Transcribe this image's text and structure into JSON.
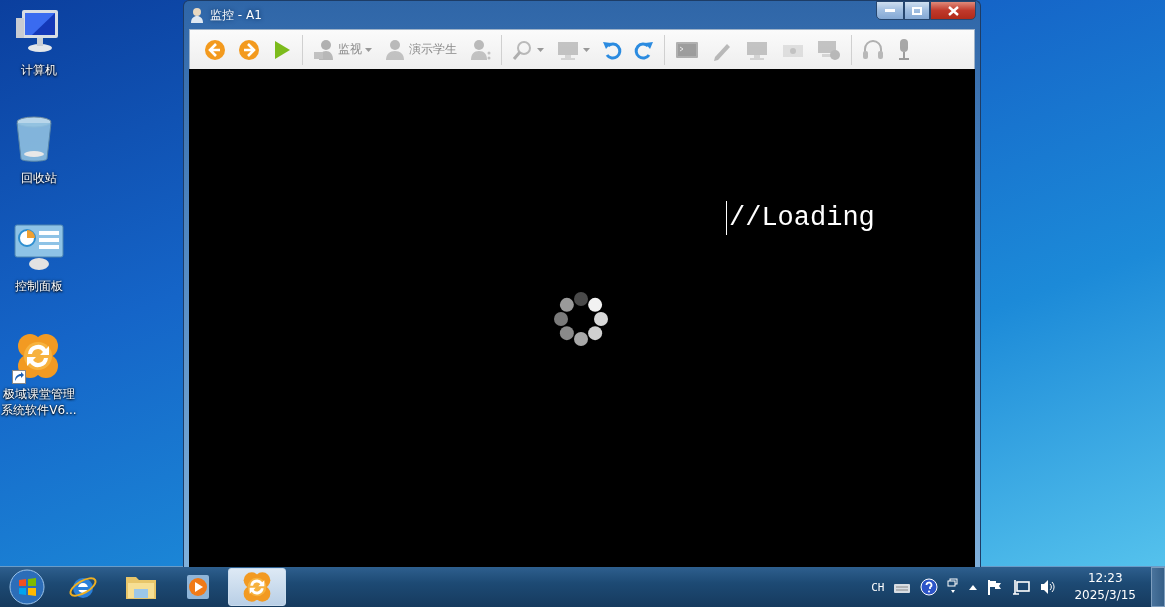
{
  "desktop": {
    "icons": [
      {
        "label": "计算机",
        "shortcut": false
      },
      {
        "label": "回收站",
        "shortcut": false
      },
      {
        "label": "控制面板",
        "shortcut": false
      },
      {
        "label": "极域课堂管理系统软件V6...",
        "shortcut": true
      }
    ]
  },
  "window": {
    "title": "监控 - A1",
    "toolbar": {
      "groups": [
        [
          {
            "disabled": false,
            "dropdown": false
          },
          {
            "disabled": false,
            "dropdown": false
          },
          {
            "disabled": false,
            "dropdown": false
          }
        ],
        [
          {
            "label": "监视",
            "disabled": true,
            "dropdown": true
          },
          {
            "label": "演示学生",
            "disabled": true,
            "dropdown": false
          },
          {
            "disabled": true,
            "dropdown": false
          }
        ],
        [
          {
            "disabled": true,
            "dropdown": true
          },
          {
            "disabled": true,
            "dropdown": true
          },
          {
            "disabled": false,
            "dropdown": false
          },
          {
            "disabled": false,
            "dropdown": false
          }
        ],
        [
          {
            "disabled": true,
            "dropdown": false
          },
          {
            "disabled": true,
            "dropdown": false
          },
          {
            "disabled": true,
            "dropdown": false
          },
          {
            "disabled": true,
            "dropdown": false
          },
          {
            "disabled": true,
            "dropdown": false
          }
        ],
        [
          {
            "disabled": true,
            "dropdown": false
          },
          {
            "disabled": true,
            "dropdown": false
          }
        ]
      ]
    },
    "content": {
      "text": "//Loading"
    }
  },
  "taskbar": {
    "apps": [
      {
        "selected": false
      },
      {
        "selected": false
      },
      {
        "selected": false
      },
      {
        "selected": true
      }
    ],
    "tray": {
      "language": "CH",
      "time": "12:23",
      "date": "2025/3/15"
    }
  }
}
